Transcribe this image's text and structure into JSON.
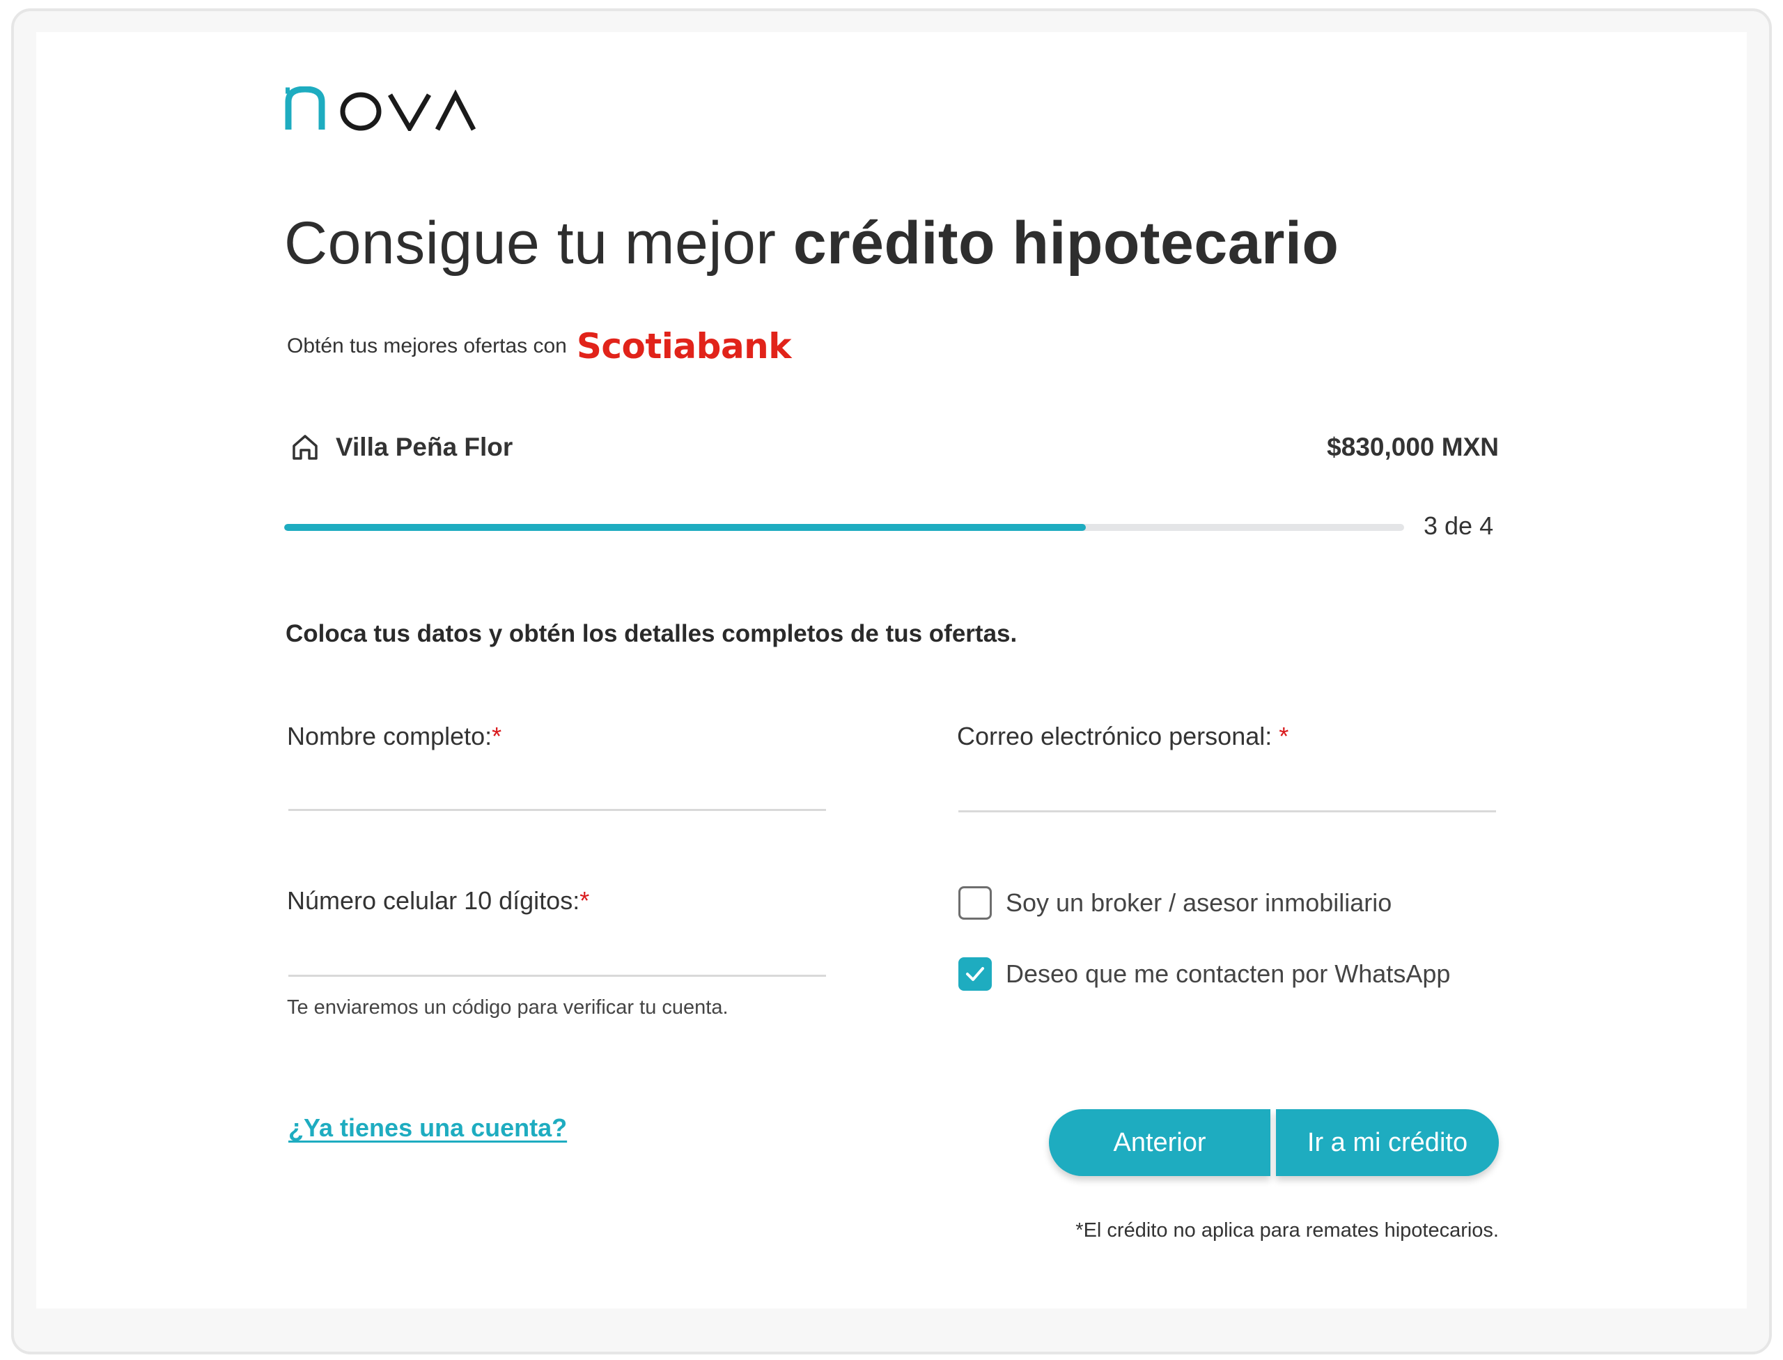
{
  "brand": {
    "logo_text": "nova",
    "accent_color": "#1eacc0"
  },
  "headline": {
    "regular": "Consigue tu mejor ",
    "bold": "crédito hipotecario"
  },
  "subline": {
    "text": "Obtén tus mejores ofertas con",
    "partner": "Scotiabank",
    "partner_color": "#e1231a"
  },
  "property": {
    "icon": "home-icon",
    "name": "Villa Peña Flor",
    "price": "$830,000 MXN"
  },
  "progress": {
    "value": 0.716,
    "step_label": "3 de 4"
  },
  "form": {
    "intro": "Coloca tus datos y obtén los detalles completos de tus ofertas.",
    "name_label": "Nombre completo:",
    "name_value": "",
    "email_label": "Correo electrónico personal: ",
    "email_value": "",
    "phone_label": "Número celular 10 dígitos:",
    "phone_value": "",
    "phone_hint": "Te enviaremos un código para verificar tu cuenta.",
    "required_mark": "*",
    "broker_label": "Soy un broker / asesor inmobiliario",
    "broker_checked": false,
    "whatsapp_label": "Deseo que me contacten por WhatsApp",
    "whatsapp_checked": true
  },
  "actions": {
    "login_link": "¿Ya tienes una cuenta?",
    "prev_label": "Anterior",
    "next_label": "Ir a mi crédito"
  },
  "disclaimer": "*El crédito no aplica para remates hipotecarios."
}
